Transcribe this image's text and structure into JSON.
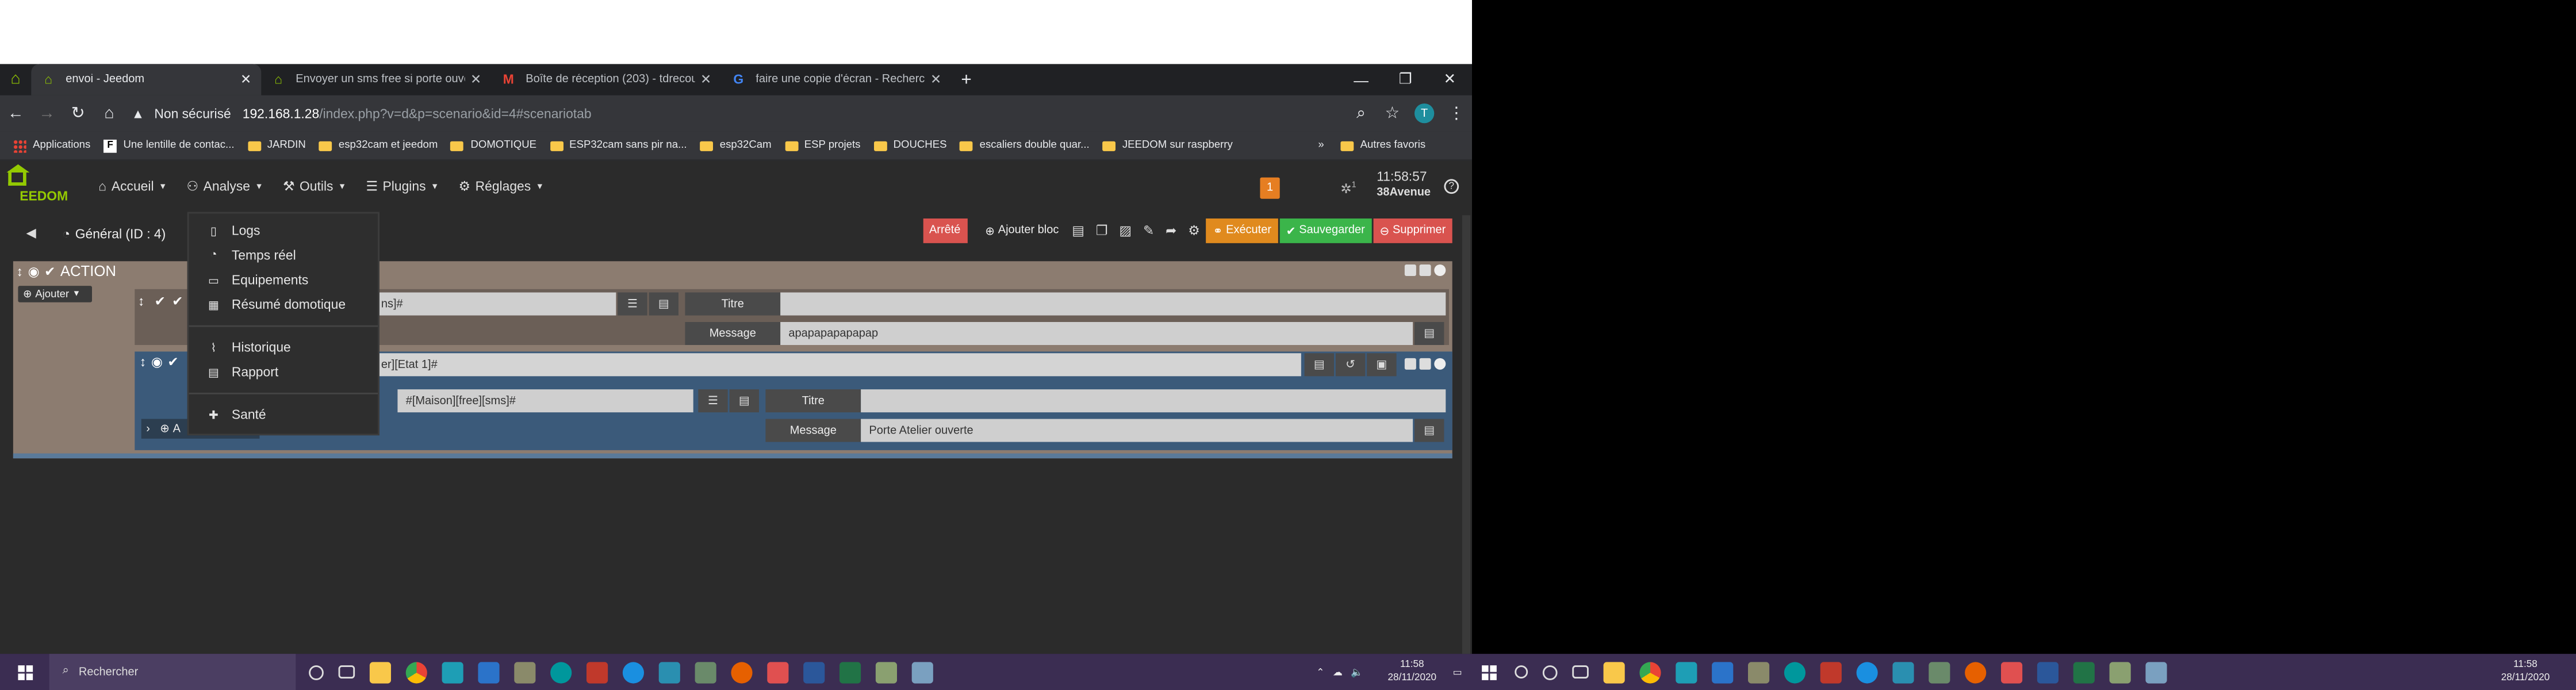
{
  "browser": {
    "tabs": [
      {
        "title": "envoi - Jeedom",
        "active": true,
        "icon": "jeedom-icon"
      },
      {
        "title": "Envoyer un sms free si porte ouverte",
        "active": false,
        "icon": "jeedom-icon"
      },
      {
        "title": "Boîte de réception (203) - tdrecourt",
        "active": false,
        "icon": "gmail-icon"
      },
      {
        "title": "faire une copie d'écran - Recherche",
        "active": false,
        "icon": "google-icon"
      }
    ],
    "new_tab": "+",
    "security_label": "Non sécurisé",
    "url_host": "192.168.1.28",
    "url_path": "/index.php?v=d&p=scenario&id=4#scenariotab",
    "profile_initial": "T",
    "bookmarks": [
      {
        "label": "Applications",
        "type": "apps"
      },
      {
        "label": "Une lentille de contac...",
        "type": "site"
      },
      {
        "label": "JARDIN",
        "type": "folder"
      },
      {
        "label": "esp32cam et jeedom",
        "type": "folder"
      },
      {
        "label": "DOMOTIQUE",
        "type": "folder"
      },
      {
        "label": "ESP32cam sans pir na...",
        "type": "folder"
      },
      {
        "label": "esp32Cam",
        "type": "folder"
      },
      {
        "label": "ESP projets",
        "type": "folder"
      },
      {
        "label": "DOUCHES",
        "type": "folder"
      },
      {
        "label": "escaliers double quar...",
        "type": "folder"
      },
      {
        "label": "JEEDOM sur raspberry",
        "type": "folder"
      }
    ],
    "bookmarks_more": "»",
    "other_bookmarks": "Autres favoris"
  },
  "jeedom": {
    "logo": "EEDOM",
    "nav": [
      {
        "label": "Accueil",
        "icon": "home-icon"
      },
      {
        "label": "Analyse",
        "icon": "analysis-icon"
      },
      {
        "label": "Outils",
        "icon": "wrench-icon"
      },
      {
        "label": "Plugins",
        "icon": "list-icon"
      },
      {
        "label": "Réglages",
        "icon": "gear-icon"
      }
    ],
    "notification_count": "1",
    "bug_count": "1",
    "time": "11:58:57",
    "location": "38Avenue",
    "scenario_title": "Général (ID : 4)",
    "status": "Arrêté",
    "add_block": "Ajouter bloc",
    "execute": "Exécuter",
    "save": "Sauvegarder",
    "delete": "Supprimer",
    "section_title": "ACTION",
    "add_label": "Ajouter",
    "action1": {
      "cmd": "ns]#",
      "title_label": "Titre",
      "title_value": "",
      "message_label": "Message",
      "message_value": "apapapapapapap"
    },
    "block2": {
      "condition": "er][Etat 1]#",
      "cmd": "#[Maison][free][sms]#",
      "title_label": "Titre",
      "title_value": "",
      "message_label": "Message",
      "message_value": "Porte Atelier ouverte",
      "add_label": "A"
    },
    "analyse_menu": [
      {
        "label": "Logs",
        "icon": "file-icon"
      },
      {
        "label": "Temps réel",
        "icon": "gauge-icon"
      },
      {
        "label": "Equipements",
        "icon": "battery-icon"
      },
      {
        "label": "Résumé domotique",
        "icon": "grid-icon"
      },
      {
        "label": "Historique",
        "icon": "chart-icon"
      },
      {
        "label": "Rapport",
        "icon": "newspaper-icon"
      },
      {
        "label": "Santé",
        "icon": "medkit-icon"
      }
    ]
  },
  "taskbar": {
    "search_placeholder": "Rechercher",
    "time": "11:58",
    "date": "28/11/2020"
  }
}
